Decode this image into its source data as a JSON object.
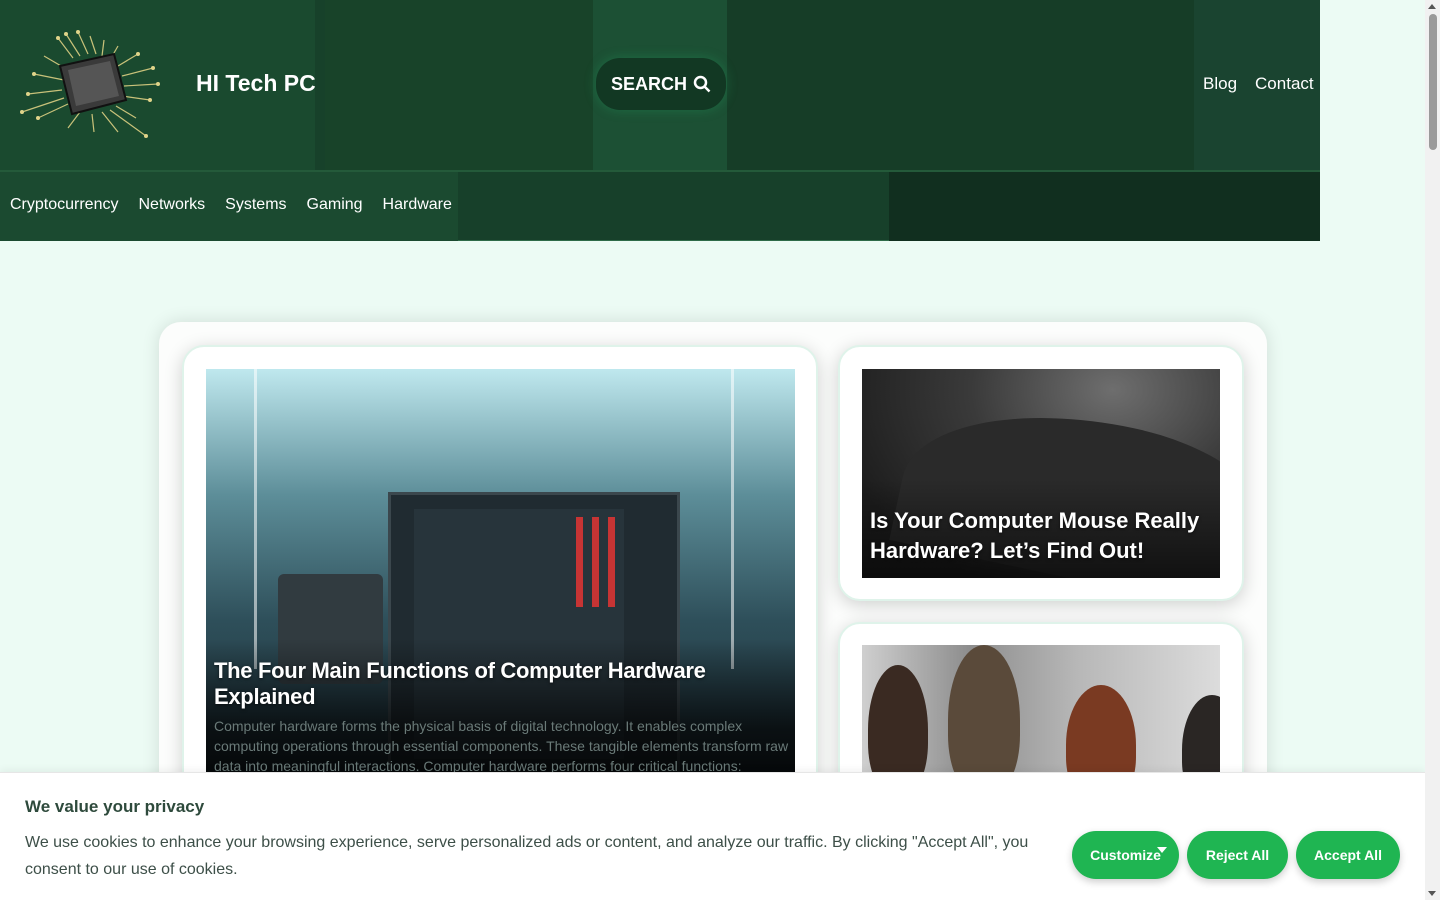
{
  "site": {
    "title": "HI Tech PC",
    "search_label": "SEARCH",
    "top_links": [
      "Blog",
      "Contact"
    ]
  },
  "categories": [
    "Cryptocurrency",
    "Networks",
    "Systems",
    "Gaming",
    "Hardware"
  ],
  "posts": {
    "featured": {
      "title": "The Four Main Functions of Computer Hardware Explained",
      "excerpt": "Computer hardware forms the physical basis of digital technology. It enables complex computing operations through essential components. These tangible elements transform raw data into meaningful interactions. Computer hardware performs four critical functions:"
    },
    "side": [
      {
        "title": "Is Your Computer Mouse Really Hardware? Let’s Find Out!"
      }
    ]
  },
  "cookie": {
    "heading": "We value your privacy",
    "text": "We use cookies to enhance your browsing experience, serve personalized ads or content, and analyze our traffic. By clicking \"Accept All\", you consent to our use of cookies.",
    "customize": "Customize",
    "reject": "Reject All",
    "accept": "Accept All"
  },
  "colors": {
    "header_bg": "#17412a",
    "page_bg": "#ecfbf4",
    "button_green": "#1fb552"
  }
}
